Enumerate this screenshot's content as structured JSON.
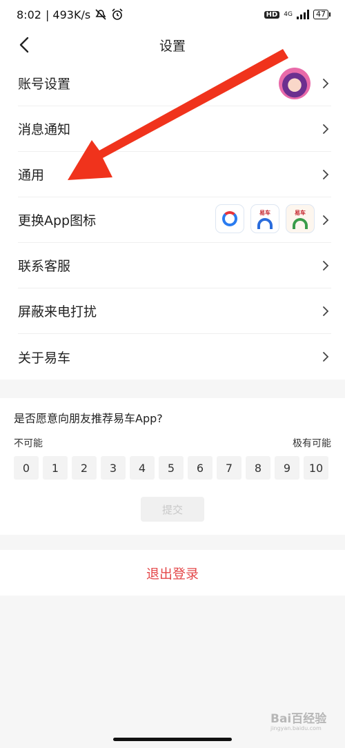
{
  "status_bar": {
    "time": "8:02",
    "speed": "| 493K/s",
    "network": "4G",
    "hd": "HD",
    "battery": "47"
  },
  "nav": {
    "title": "设置"
  },
  "settings": {
    "items": [
      {
        "label": "账号设置"
      },
      {
        "label": "消息通知"
      },
      {
        "label": "通用"
      },
      {
        "label": "更换App图标"
      },
      {
        "label": "联系客服"
      },
      {
        "label": "屏蔽来电打扰"
      },
      {
        "label": "关于易车"
      }
    ],
    "app_icon_brand": "易车"
  },
  "survey": {
    "question": "是否愿意向朋友推荐易车App?",
    "low_label": "不可能",
    "high_label": "极有可能",
    "scores": [
      "0",
      "1",
      "2",
      "3",
      "4",
      "5",
      "6",
      "7",
      "8",
      "9",
      "10"
    ],
    "submit_label": "提交"
  },
  "logout": {
    "label": "退出登录"
  },
  "watermark": {
    "brand": "Bai百经验",
    "url": "jingyan.baidu.com"
  },
  "colors": {
    "accent_red": "#e4484a",
    "arrow_red": "#f0331c",
    "text": "#222222",
    "background": "#f6f6f6"
  }
}
